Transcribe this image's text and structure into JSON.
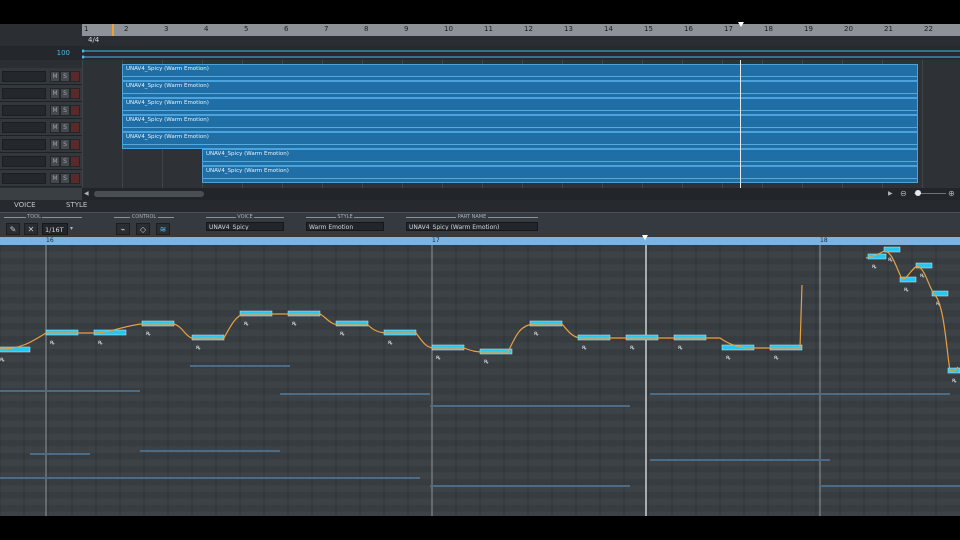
{
  "timeline": {
    "bars": [
      "1",
      "2",
      "3",
      "4",
      "5",
      "6",
      "7",
      "8",
      "9",
      "10",
      "11",
      "12",
      "13",
      "14",
      "15",
      "16",
      "17",
      "18",
      "19",
      "20",
      "21",
      "22"
    ],
    "time_signature": "4/4",
    "master_value": "100"
  },
  "tracks": [
    {
      "mute_label": "M",
      "solo_label": "S"
    },
    {
      "mute_label": "M",
      "solo_label": "S"
    },
    {
      "mute_label": "M",
      "solo_label": "S"
    },
    {
      "mute_label": "M",
      "solo_label": "S"
    },
    {
      "mute_label": "M",
      "solo_label": "S"
    },
    {
      "mute_label": "M",
      "solo_label": "S"
    },
    {
      "mute_label": "M",
      "solo_label": "S"
    }
  ],
  "parts": [
    {
      "label": "UNAV4_Spicy (Warm Emotion)"
    },
    {
      "label": "UNAV4_Spicy (Warm Emotion)"
    },
    {
      "label": "UNAV4_Spicy (Warm Emotion)"
    },
    {
      "label": "UNAV4_Spicy (Warm Emotion)"
    },
    {
      "label": "UNAV4_Spicy (Warm Emotion)"
    },
    {
      "label": "UNAV4_Spicy (Warm Emotion)"
    },
    {
      "label": "UNAV4_Spicy (Warm Emotion)"
    }
  ],
  "tabs": {
    "voice": "VOICE",
    "style": "STYLE"
  },
  "toolbar": {
    "tool_label": "TOOL",
    "quantize": "1/16T",
    "control_label": "CONTROL",
    "voice_label": "VOICE",
    "voice_value": "UNAV4_Spicy",
    "style_label": "STYLE",
    "style_value": "Warm Emotion",
    "part_name_label": "PART NAME",
    "part_name_value": "UNAV4_Spicy (Warm Emotion)"
  },
  "piano_roll": {
    "measures": [
      "16",
      "17",
      "18"
    ]
  },
  "colors": {
    "part_fill": "#1f6fa6",
    "note": "#29c6ef",
    "pitch_curve": "#e8a040",
    "ruler_roll": "#7fb3dd"
  }
}
